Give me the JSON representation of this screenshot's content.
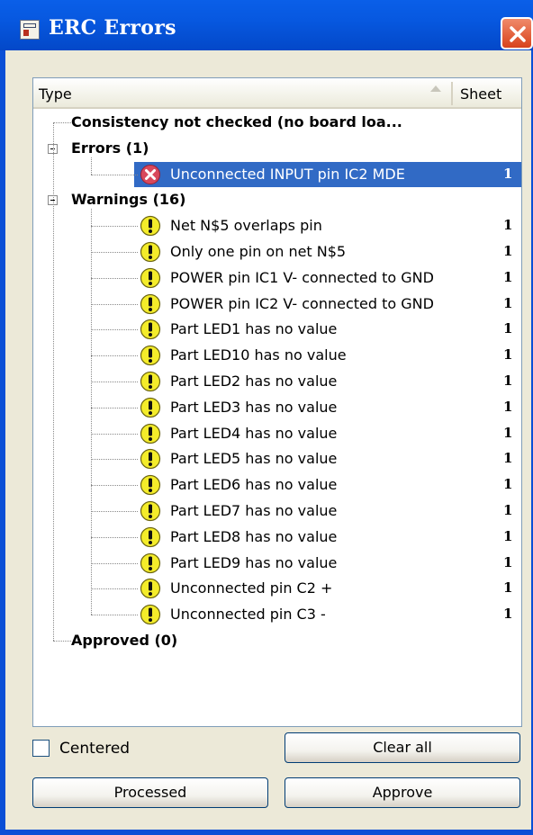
{
  "window": {
    "title": "ERC Errors"
  },
  "tree": {
    "columns": {
      "type": "Type",
      "sheet": "Sheet"
    },
    "consistency": "Consistency not checked (no board loa...",
    "errors_header": "Errors (1)",
    "errors": [
      {
        "label": "Unconnected INPUT pin IC2 MDE",
        "sheet": "1",
        "selected": true
      }
    ],
    "warnings_header": "Warnings (16)",
    "warnings": [
      {
        "label": "Net N$5 overlaps pin",
        "sheet": "1"
      },
      {
        "label": "Only one pin on net N$5",
        "sheet": "1"
      },
      {
        "label": "POWER pin IC1 V- connected to GND",
        "sheet": "1"
      },
      {
        "label": "POWER pin IC2 V- connected to GND",
        "sheet": "1"
      },
      {
        "label": "Part LED1 has no value",
        "sheet": "1"
      },
      {
        "label": "Part LED10 has no value",
        "sheet": "1"
      },
      {
        "label": "Part LED2 has no value",
        "sheet": "1"
      },
      {
        "label": "Part LED3 has no value",
        "sheet": "1"
      },
      {
        "label": "Part LED4 has no value",
        "sheet": "1"
      },
      {
        "label": "Part LED5 has no value",
        "sheet": "1"
      },
      {
        "label": "Part LED6 has no value",
        "sheet": "1"
      },
      {
        "label": "Part LED7 has no value",
        "sheet": "1"
      },
      {
        "label": "Part LED8 has no value",
        "sheet": "1"
      },
      {
        "label": "Part LED9 has no value",
        "sheet": "1"
      },
      {
        "label": "Unconnected pin C2 +",
        "sheet": "1"
      },
      {
        "label": "Unconnected pin C3 -",
        "sheet": "1"
      }
    ],
    "approved_header": "Approved (0)"
  },
  "controls": {
    "centered_label": "Centered",
    "centered_checked": false,
    "clear_all": "Clear all",
    "processed": "Processed",
    "approve": "Approve"
  },
  "colors": {
    "selection": "#316ac5",
    "titlebar": "#0a5fe8",
    "dialog": "#ece9d8"
  },
  "icons": {
    "error": "error-icon",
    "warning": "warning-icon"
  }
}
